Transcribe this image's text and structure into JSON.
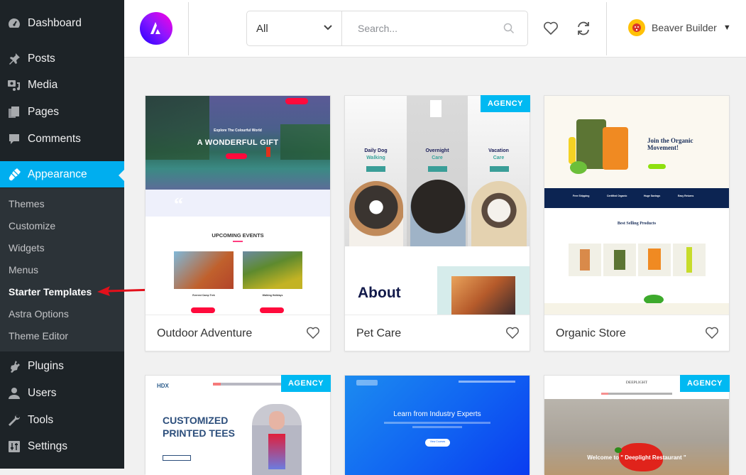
{
  "sidebar": {
    "menu": [
      {
        "label": "Dashboard",
        "icon": "dashboard-icon"
      },
      {
        "label": "Posts",
        "icon": "pin-icon"
      },
      {
        "label": "Media",
        "icon": "media-icon"
      },
      {
        "label": "Pages",
        "icon": "pages-icon"
      },
      {
        "label": "Comments",
        "icon": "comment-icon"
      },
      {
        "label": "Appearance",
        "icon": "paintbrush-icon",
        "active": true
      },
      {
        "label": "Plugins",
        "icon": "plugin-icon"
      },
      {
        "label": "Users",
        "icon": "user-icon"
      },
      {
        "label": "Tools",
        "icon": "wrench-icon"
      },
      {
        "label": "Settings",
        "icon": "settings-icon"
      }
    ],
    "submenu": [
      {
        "label": "Themes"
      },
      {
        "label": "Customize"
      },
      {
        "label": "Widgets"
      },
      {
        "label": "Menus"
      },
      {
        "label": "Starter Templates",
        "current": true
      },
      {
        "label": "Astra Options"
      },
      {
        "label": "Theme Editor"
      }
    ]
  },
  "header": {
    "filter_selected": "All",
    "search_placeholder": "Search...",
    "builder_label": "Beaver Builder"
  },
  "templates": [
    {
      "name": "Outdoor Adventure",
      "badge": null,
      "preview": {
        "eyebrow": "Explore The Colourful World",
        "headline": "A WONDERFUL GIFT",
        "section": "UPCOMING EVENTS",
        "event1": "Everest Camp Trek",
        "event2": "Walking Holidays"
      }
    },
    {
      "name": "Pet Care",
      "badge": "AGENCY",
      "preview": {
        "col1a": "Daily Dog",
        "col1b": "Walking",
        "col2a": "Overnight",
        "col2b": "Care",
        "col3a": "Vacation",
        "col3b": "Care",
        "about": "About"
      }
    },
    {
      "name": "Organic Store",
      "badge": null,
      "preview": {
        "headline1": "Join the Organic",
        "headline2": "Movement!",
        "section": "Best Selling Products",
        "f1": "Free Shipping",
        "f2": "Certified Organic",
        "f3": "Huge Savings",
        "f4": "Easy Returns"
      }
    },
    {
      "name": "",
      "badge": "AGENCY",
      "preview": {
        "headline1": "CUSTOMIZED",
        "headline2": "PRINTED TEES"
      }
    },
    {
      "name": "",
      "badge": null,
      "preview": {
        "headline": "Learn from Industry Experts",
        "cta": "View Courses"
      }
    },
    {
      "name": "",
      "badge": "AGENCY",
      "preview": {
        "brand": "DEEPLIGHT",
        "headline": "Welcome to \" Deeplight Restaurant \""
      }
    }
  ],
  "colors": {
    "sidebar_bg": "#1d2327",
    "submenu_bg": "#2c3338",
    "active": "#00aeef",
    "badge": "#00b9f2",
    "annotation_arrow": "#e3101b"
  }
}
